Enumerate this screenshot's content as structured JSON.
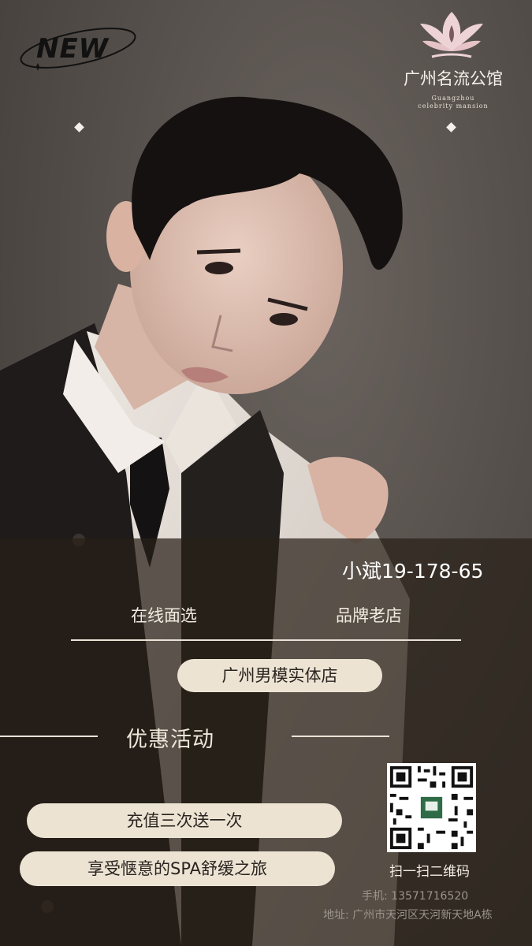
{
  "badge": {
    "text": "NEW"
  },
  "brand": {
    "name": "广州名流公馆",
    "en_line1": "Guangzhou",
    "en_line2": "celebrity mansion",
    "logo_icon": "lotus-icon"
  },
  "contact_name": "小斌19-178-65",
  "tags": {
    "left": "在线面选",
    "right": "品牌老店"
  },
  "store_pill": "广州男模实体店",
  "promo": {
    "title": "优惠活动",
    "items": [
      "充值三次送一次",
      "享受惬意的SPA舒缓之旅"
    ]
  },
  "qr": {
    "caption": "扫一扫二维码",
    "icon": "qr-code-icon"
  },
  "footer": {
    "phone_label": "手机:",
    "phone": "13571716520",
    "address_label": "地址:",
    "address": "广州市天河区天河新天地A栋"
  },
  "colors": {
    "pill_bg": "#ece3d3",
    "overlay": "#28201a",
    "text_light": "#f1ebe2"
  }
}
